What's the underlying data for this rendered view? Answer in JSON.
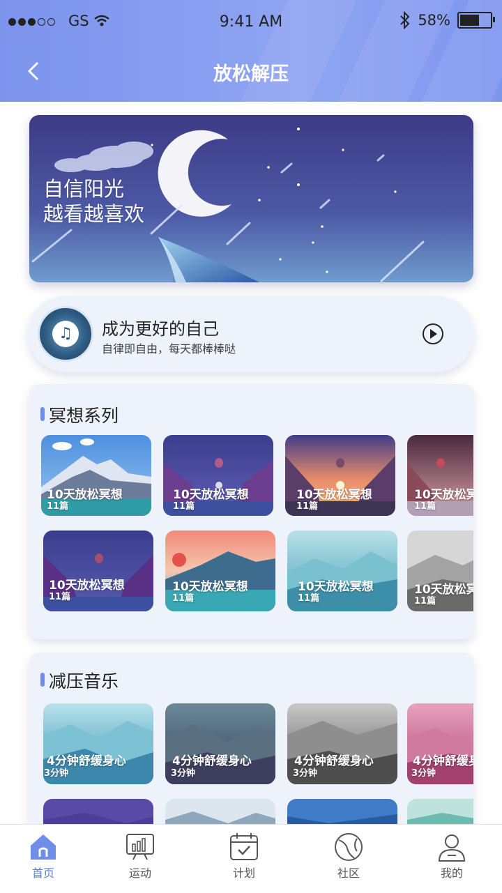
{
  "status_bar": {
    "carrier": "GS",
    "time": "9:41 AM",
    "battery": "58%",
    "battery_level": 0.58
  },
  "nav": {
    "title": "放松解压",
    "back_icon": "chevron-left-icon"
  },
  "banner": {
    "line1": "自信阳光",
    "line2": "越看越喜欢"
  },
  "player": {
    "title": "成为更好的自己",
    "subtitle": "自律即自由，每天都棒棒哒",
    "play_icon": "play-circle-icon"
  },
  "meditation": {
    "title": "冥想系列",
    "rows": [
      [
        {
          "name": "10天放松冥想",
          "count": "11篇"
        },
        {
          "name": "10天放松冥想",
          "count": "11篇"
        },
        {
          "name": "10天放松冥想",
          "count": "11篇"
        },
        {
          "name": "10天放松冥",
          "count": "11篇"
        }
      ],
      [
        {
          "name": "10天放松冥想",
          "count": "11篇"
        },
        {
          "name": "10天放松冥想",
          "count": "11篇"
        },
        {
          "name": "10天放松冥想",
          "count": "11篇"
        },
        {
          "name": "10天放松冥",
          "count": "11篇"
        }
      ]
    ]
  },
  "music": {
    "title": "减压音乐",
    "rows": [
      [
        {
          "name": "4分钟舒缓身心",
          "count": "3分钟"
        },
        {
          "name": "4分钟舒缓身心",
          "count": "3分钟"
        },
        {
          "name": "4分钟舒缓身心",
          "count": "3分钟"
        },
        {
          "name": "4分钟舒缓身",
          "count": "3分钟"
        }
      ]
    ]
  },
  "tabs": [
    {
      "label": "首页",
      "icon": "home-icon",
      "active": true
    },
    {
      "label": "运动",
      "icon": "chart-board-icon",
      "active": false
    },
    {
      "label": "计划",
      "icon": "calendar-check-icon",
      "active": false
    },
    {
      "label": "社区",
      "icon": "globe-icon",
      "active": false
    },
    {
      "label": "我的",
      "icon": "user-icon",
      "active": false
    }
  ],
  "colors": {
    "header": "#7d94ee",
    "accent": "#5b7fe6",
    "section_bg": "#eef2fb"
  }
}
